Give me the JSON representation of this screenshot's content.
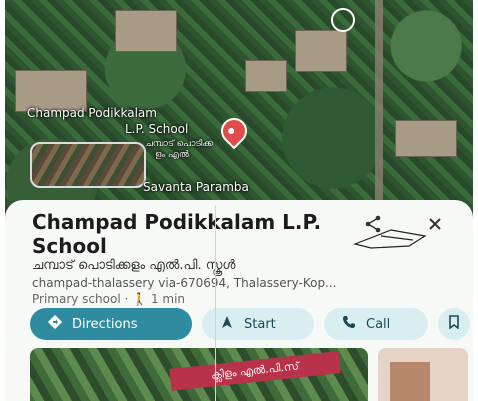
{
  "map": {
    "label_en": "Champad Podikkalam",
    "label_en_2": "L.P. School",
    "label_ml": "ചമ്പാട് പൊടിക്ക",
    "label_ml_2": "ളം എൽ",
    "place_label": "Savanta Paramba"
  },
  "place": {
    "title": "Champad Podikkalam L.P. School",
    "name_ml": "ചമ്പാട് പൊടിക്കളം എൽ.പി. സ്കൂൾ",
    "address": "champad-thalassery via-670694, Thalassery-Kop...",
    "category": "Primary school",
    "separator": "·",
    "walk_time": "1 min"
  },
  "actions": {
    "directions": "Directions",
    "start": "Start",
    "call": "Call"
  },
  "photo_banner_text": "ക്ലിളം എൽ.പി.സ്",
  "icons": {
    "share": "share-icon",
    "close": "close-icon",
    "directions": "directions-icon",
    "start": "navigation-arrow-icon",
    "call": "phone-icon",
    "save": "bookmark-icon",
    "walk": "walking-person-icon"
  },
  "colors": {
    "primary_button": "#2f8ca0",
    "tonal_button": "#d9eef1",
    "pin": "#e04b4b"
  }
}
